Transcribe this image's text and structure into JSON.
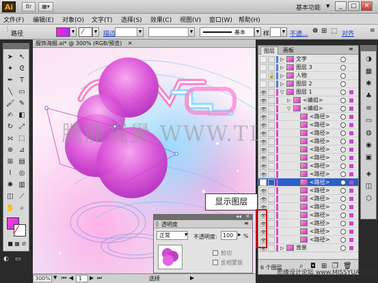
{
  "app": {
    "logo": "Ai",
    "workspace": "基本功能",
    "window_buttons": [
      "_",
      "□",
      "✕"
    ]
  },
  "menu": [
    "文件(F)",
    "编辑(E)",
    "对象(O)",
    "文字(T)",
    "选择(S)",
    "效果(C)",
    "视图(V)",
    "窗口(W)",
    "帮助(H)"
  ],
  "control": {
    "selection": "路径",
    "stroke_label": "描边:",
    "style_label": "基本",
    "style2": "样式:",
    "opacity_link": "不透...",
    "align_link": "对齐"
  },
  "document": {
    "tab_title": "服饰海报.ai* @ 300% (RGB/预览)",
    "zoom": "300%",
    "page": "1",
    "status_text": "选择"
  },
  "layers": {
    "tabs": [
      "图层",
      "画板"
    ],
    "rows": [
      {
        "name": "文字",
        "indent": 0
      },
      {
        "name": "图层 3",
        "indent": 0
      },
      {
        "name": "人物",
        "indent": 0
      },
      {
        "name": "图层 2",
        "indent": 0
      },
      {
        "name": "图层 1",
        "indent": 0
      },
      {
        "name": "<编组>",
        "indent": 1
      },
      {
        "name": "<编组>",
        "indent": 1
      },
      {
        "name": "<路径>",
        "indent": 2
      },
      {
        "name": "<路径>",
        "indent": 2
      },
      {
        "name": "<路径>",
        "indent": 2
      },
      {
        "name": "<路径>",
        "indent": 2
      },
      {
        "name": "<路径>",
        "indent": 2
      },
      {
        "name": "<路径>",
        "indent": 2
      },
      {
        "name": "<路径>",
        "indent": 2
      },
      {
        "name": "<路径>",
        "indent": 2
      },
      {
        "name": "<路径>",
        "indent": 2
      },
      {
        "name": "<路径>",
        "indent": 2
      },
      {
        "name": "<路径>",
        "indent": 2
      },
      {
        "name": "<路径>",
        "indent": 2
      },
      {
        "name": "<路径>",
        "indent": 2
      },
      {
        "name": "<路径>",
        "indent": 2
      },
      {
        "name": "<路径>",
        "indent": 2
      },
      {
        "name": "<路径>",
        "indent": 2
      },
      {
        "name": "背景",
        "indent": 0
      }
    ],
    "footer_count": "6 个图层"
  },
  "transparency": {
    "title": "透明度",
    "blend_mode": "正常",
    "opacity_label": "不透明度:",
    "opacity_value": "100",
    "opacity_unit": "%",
    "clip_label": "剪切",
    "invert_label": "反相蒙版"
  },
  "callout": "显示图层",
  "watermark": "騰龍視覺 WWW.TL-",
  "site_credit": "思缘设计论坛 www.MISSYUAN.COM",
  "colors": {
    "accent_pink": "#dd44cc",
    "highlight_red": "#d01010",
    "selected_row": "#2a5fc9"
  }
}
